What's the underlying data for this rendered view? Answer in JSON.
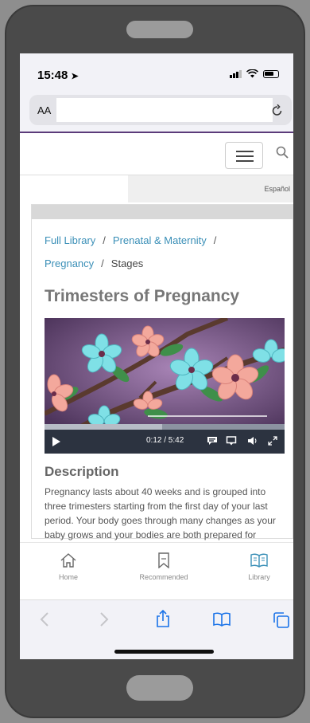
{
  "status_bar": {
    "time": "15:48"
  },
  "address_bar": {
    "text_size_label": "AA",
    "url": "",
    "reload_icon": "reload-icon"
  },
  "header": {
    "menu_icon": "hamburger-icon",
    "search_icon": "search-icon",
    "language_link": "Español"
  },
  "breadcrumb": {
    "items": [
      {
        "label": "Full Library",
        "link": true
      },
      {
        "label": "Prenatal & Maternity",
        "link": true
      },
      {
        "label": "Pregnancy",
        "link": true
      },
      {
        "label": "Stages",
        "link": false
      }
    ],
    "separator": "/"
  },
  "page": {
    "title": "Trimesters of Pregnancy"
  },
  "video": {
    "current_time": "0:12",
    "duration": "5:42",
    "time_display": "0:12 / 5:42",
    "progress_fraction": 0.49,
    "controls": [
      "play-icon",
      "captions-icon",
      "transcript-icon",
      "volume-icon",
      "fullscreen-icon"
    ]
  },
  "description": {
    "heading": "Description",
    "text": "Pregnancy lasts about 40 weeks and is grouped into three trimesters starting from the first day of your last period. Your body goes through many changes as your baby grows and your bodies are both prepared for"
  },
  "tab_bar": {
    "items": [
      {
        "label": "Home",
        "icon": "home-icon",
        "active": false
      },
      {
        "label": "Recommended",
        "icon": "bookmark-icon",
        "active": false
      },
      {
        "label": "Library",
        "icon": "book-icon",
        "active": true
      }
    ]
  },
  "safari_toolbar": {
    "icons": [
      "back-icon",
      "forward-icon",
      "share-icon",
      "bookmarks-icon",
      "tabs-icon"
    ]
  },
  "colors": {
    "link": "#3a8fb7",
    "accent": "#5b3b7a",
    "active_tab": "#3a8fb7"
  }
}
